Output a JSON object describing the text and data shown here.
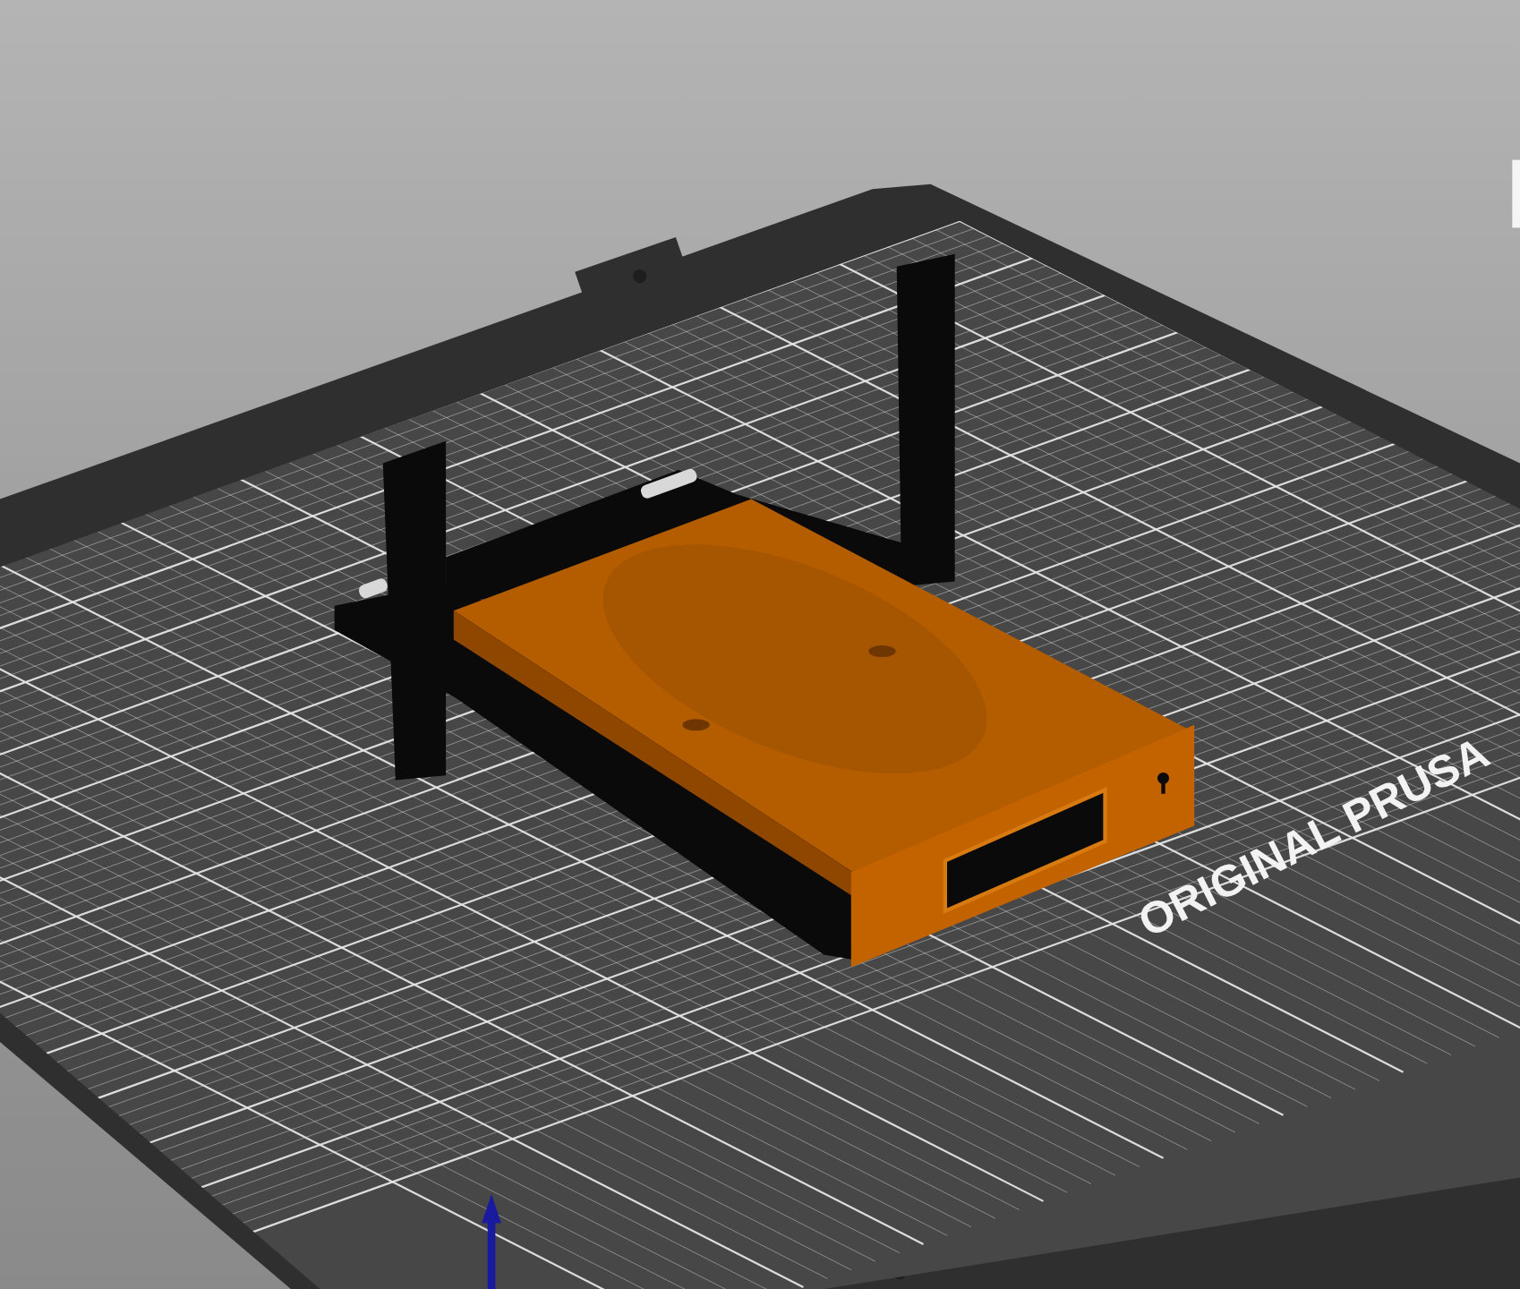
{
  "viewport": {
    "bed_label": "ORIGINAL PRUSA"
  }
}
